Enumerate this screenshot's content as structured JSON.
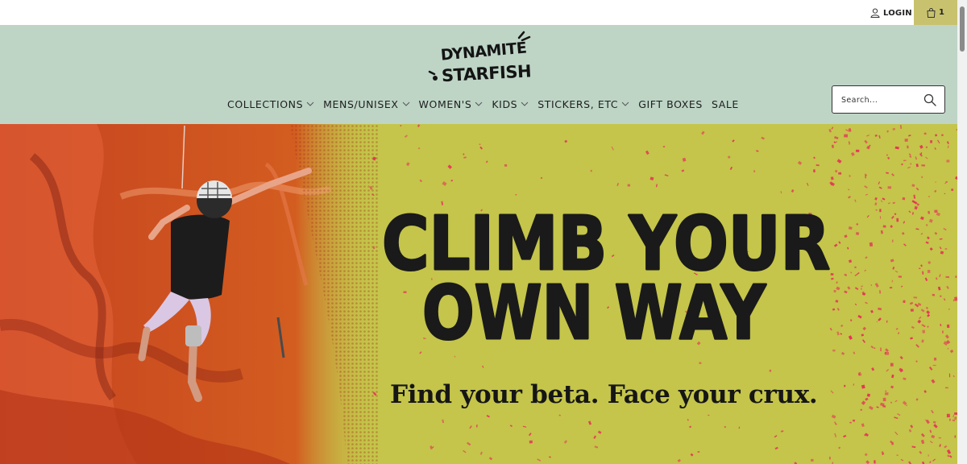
{
  "header": {
    "login_label": "LOGIN",
    "cart_count": "1",
    "logo_line1": "DYNAMITE",
    "logo_line2": "STARFISH",
    "nav": [
      {
        "label": "COLLECTIONS",
        "has_dropdown": true
      },
      {
        "label": "MENS/UNISEX",
        "has_dropdown": true
      },
      {
        "label": "WOMEN'S",
        "has_dropdown": true
      },
      {
        "label": "KIDS",
        "has_dropdown": true
      },
      {
        "label": "STICKERS, ETC",
        "has_dropdown": true
      },
      {
        "label": "GIFT BOXES",
        "has_dropdown": false
      },
      {
        "label": "SALE",
        "has_dropdown": false
      }
    ],
    "search_placeholder": "Search..."
  },
  "hero": {
    "headline_line1": "CLIMB YOUR",
    "headline_line2": "OWN WAY",
    "tagline": "Find your beta. Face your crux."
  },
  "colors": {
    "header_bg": "#bed5c6",
    "cart_bg": "#c8c26e",
    "hero_bg": "#c4c54a",
    "speckle": "#e8315a",
    "rock": "#c5421f"
  },
  "icons": [
    "user-icon",
    "bag-icon",
    "chevron-down-icon",
    "search-icon"
  ]
}
